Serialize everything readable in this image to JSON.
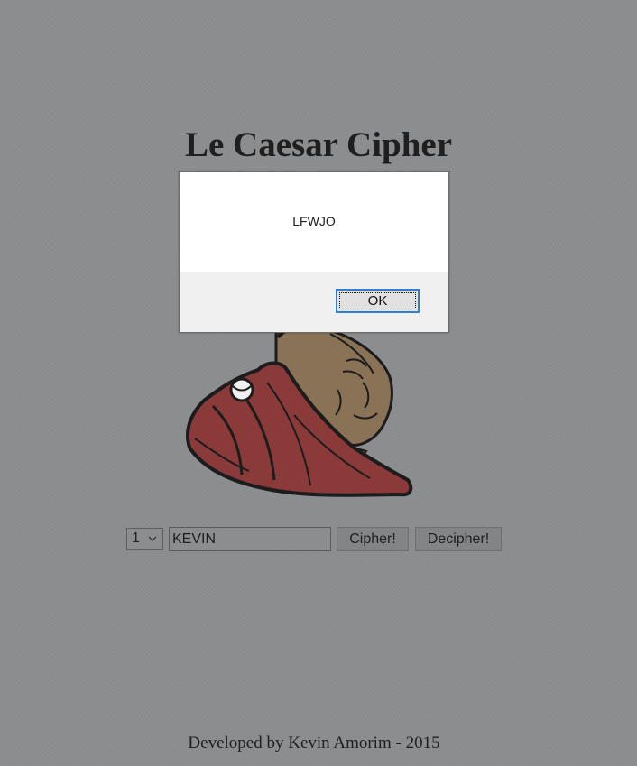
{
  "page": {
    "title": "Le Caesar Cipher",
    "footer": "Developed by Kevin Amorim - 2015"
  },
  "form": {
    "shift_value": "1",
    "text_value": "KEVIN",
    "cipher_label": "Cipher!",
    "decipher_label": "Decipher!"
  },
  "alert": {
    "message": "LFWJO",
    "ok_label": "OK"
  },
  "icons": {
    "select_arrow": "chevron-down-icon",
    "illustration": "caesar-bust-illustration"
  },
  "colors": {
    "background": "#8c8d8f",
    "toga": "#8b3a3a",
    "skin": "#8a7256",
    "dialog_accent": "#2f7fd2"
  }
}
